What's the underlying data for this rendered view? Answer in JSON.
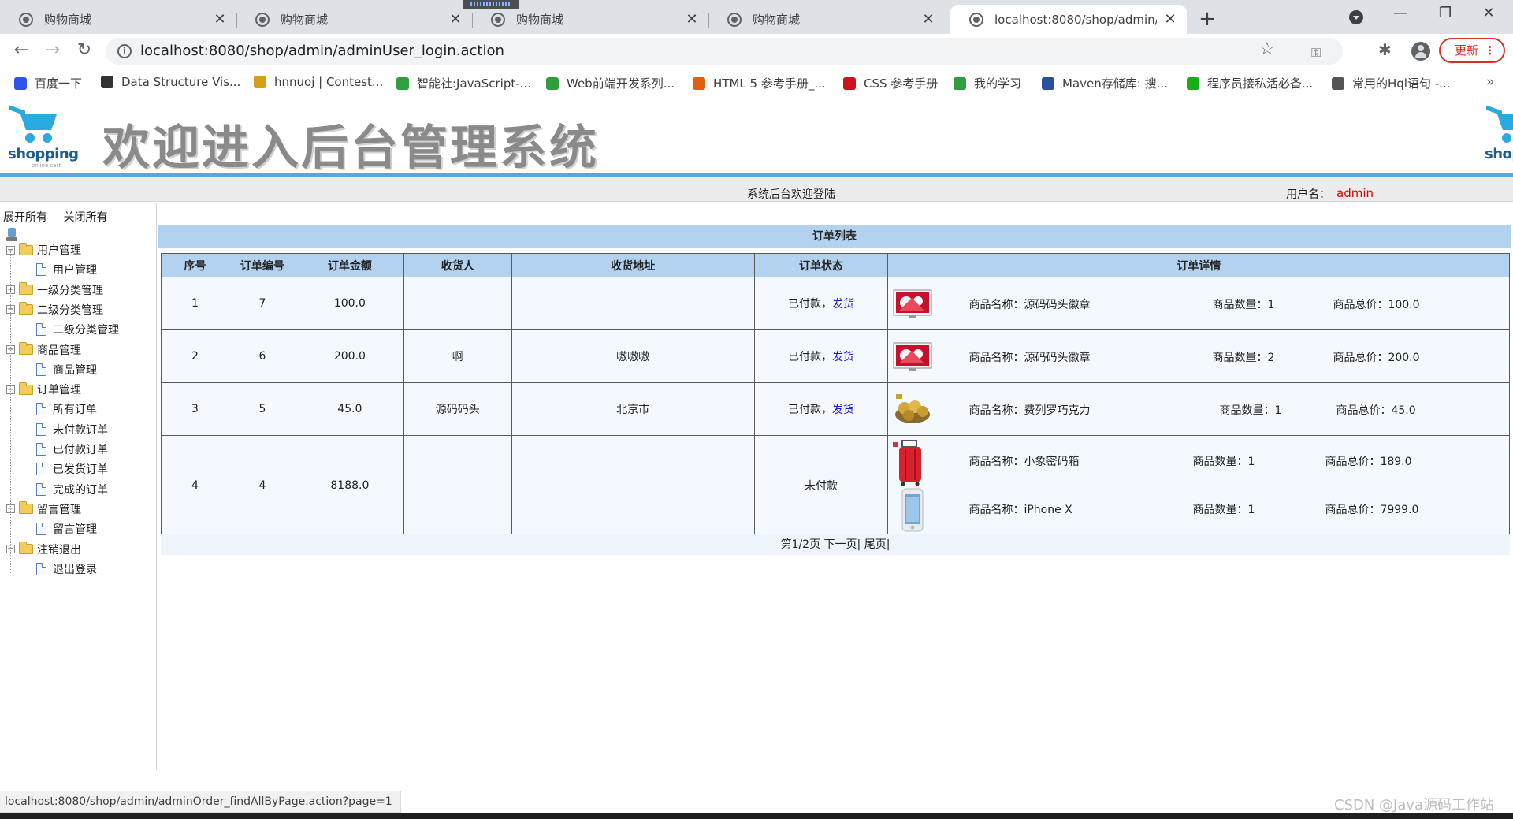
{
  "browser": {
    "tabs": [
      {
        "title": "购物商城"
      },
      {
        "title": "购物商城"
      },
      {
        "title": "购物商城"
      },
      {
        "title": "购物商城"
      },
      {
        "title": "localhost:8080/shop/admin/ac"
      }
    ],
    "new_tab": "+",
    "url": "localhost:8080/shop/admin/adminUser_login.action",
    "update_label": "更新",
    "bookmarks": [
      {
        "label": "百度一下",
        "color": "#2f54eb"
      },
      {
        "label": "Data Structure Vis...",
        "color": "#333333"
      },
      {
        "label": "hnnuoj | Contest...",
        "color": "#d4a017"
      },
      {
        "label": "智能社:JavaScript-...",
        "color": "#2e9e3e"
      },
      {
        "label": "Web前端开发系列...",
        "color": "#2e9e3e"
      },
      {
        "label": "HTML 5 参考手册_...",
        "color": "#e06010"
      },
      {
        "label": "CSS 参考手册",
        "color": "#d0101a"
      },
      {
        "label": "我的学习",
        "color": "#2e9e3e"
      },
      {
        "label": "Maven存储库: 搜...",
        "color": "#2a4f9e"
      },
      {
        "label": "程序员接私活必备...",
        "color": "#1aad19"
      },
      {
        "label": "常用的Hql语句 -...",
        "color": "#555555"
      }
    ],
    "status_url": "localhost:8080/shop/admin/adminOrder_findAllByPage.action?page=1"
  },
  "header": {
    "logo_text": "shopping",
    "logo_subtext": "online cart",
    "title": "欢迎进入后台管理系统",
    "welcome": "系统后台欢迎登陆",
    "user_label": "用户名：",
    "user_value": "admin"
  },
  "sidebar": {
    "expand_all": "展开所有",
    "collapse_all": "关闭所有",
    "groups": [
      {
        "label": "用户管理",
        "expanded": true,
        "items": [
          "用户管理"
        ]
      },
      {
        "label": "一级分类管理",
        "expanded": false,
        "items": []
      },
      {
        "label": "二级分类管理",
        "expanded": true,
        "items": [
          "二级分类管理"
        ]
      },
      {
        "label": "商品管理",
        "expanded": true,
        "items": [
          "商品管理"
        ]
      },
      {
        "label": "订单管理",
        "expanded": true,
        "items": [
          "所有订单",
          "未付款订单",
          "已付款订单",
          "已发货订单",
          "完成的订单"
        ]
      },
      {
        "label": "留言管理",
        "expanded": true,
        "items": [
          "留言管理"
        ]
      },
      {
        "label": "注销退出",
        "expanded": true,
        "items": [
          "退出登录"
        ]
      }
    ]
  },
  "orders": {
    "title": "订单列表",
    "columns": [
      "序号",
      "订单编号",
      "订单金额",
      "收货人",
      "收货地址",
      "订单状态",
      "订单详情"
    ],
    "detail_labels": {
      "name": "商品名称：",
      "qty": "商品数量：",
      "total": "商品总价："
    },
    "rows": [
      {
        "seq": "1",
        "id": "7",
        "amount": "100.0",
        "receiver": "",
        "address": "",
        "status": "已付款，",
        "action": "发货",
        "items": [
          {
            "name": "源码码头徽章",
            "qty": "1",
            "total": "100.0",
            "thumb": "badge"
          }
        ]
      },
      {
        "seq": "2",
        "id": "6",
        "amount": "200.0",
        "receiver": "啊",
        "address": "嗷嗷嗷",
        "status": "已付款，",
        "action": "发货",
        "items": [
          {
            "name": "源码码头徽章",
            "qty": "2",
            "total": "200.0",
            "thumb": "badge"
          }
        ]
      },
      {
        "seq": "3",
        "id": "5",
        "amount": "45.0",
        "receiver": "源码码头",
        "address": "北京市",
        "status": "已付款，",
        "action": "发货",
        "items": [
          {
            "name": "费列罗巧克力",
            "qty": "1",
            "total": "45.0",
            "thumb": "chocolate"
          }
        ]
      },
      {
        "seq": "4",
        "id": "4",
        "amount": "8188.0",
        "receiver": "",
        "address": "",
        "status": "未付款",
        "action": "",
        "items": [
          {
            "name": "小象密码箱",
            "qty": "1",
            "total": "189.0",
            "thumb": "suitcase"
          },
          {
            "name": "iPhone X",
            "qty": "1",
            "total": "7999.0",
            "thumb": "phone"
          }
        ]
      }
    ],
    "pager": {
      "page": "第1/2页",
      "next": "下一页|",
      "last": "尾页|"
    }
  },
  "watermark": "CSDN @Java源码工作站"
}
